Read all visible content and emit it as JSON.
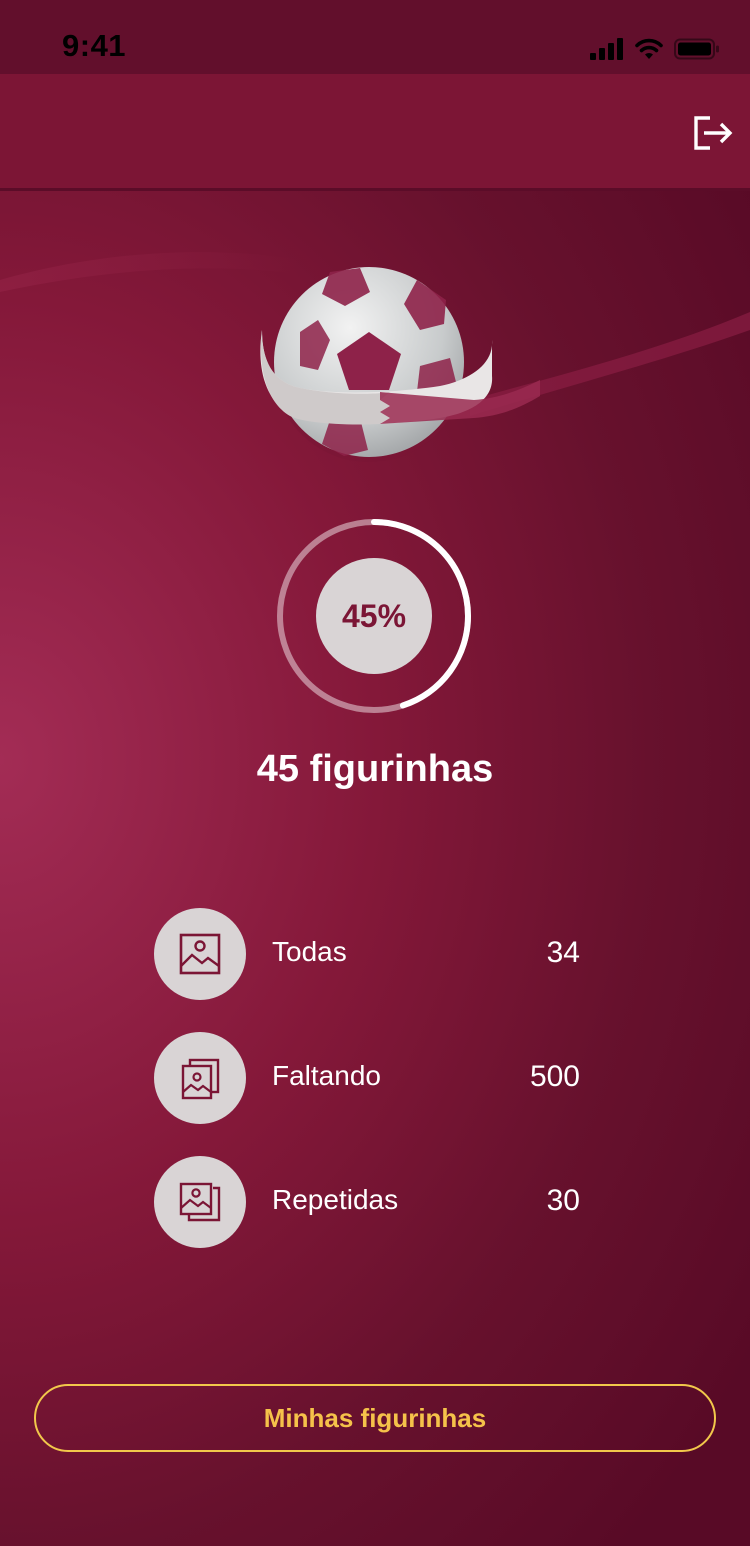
{
  "status_bar": {
    "time": "9:41"
  },
  "progress": {
    "percent_label": "45%",
    "fraction": 0.45
  },
  "summary": {
    "count_label": "45 figurinhas"
  },
  "stats": [
    {
      "label": "Todas",
      "value": "34",
      "icon": "image-icon"
    },
    {
      "label": "Faltando",
      "value": "500",
      "icon": "image-stack-icon"
    },
    {
      "label": "Repetidas",
      "value": "30",
      "icon": "image-duplicate-icon"
    }
  ],
  "actions": {
    "primary_label": "Minhas figurinhas"
  },
  "icons": {
    "header_action": "logout-icon",
    "hero": "soccer-ball-icon"
  },
  "colors": {
    "brand": "#7b1535",
    "background": "#841839",
    "accent": "#f2c84b",
    "circle": "#d9d4d5",
    "text": "#ffffff"
  }
}
